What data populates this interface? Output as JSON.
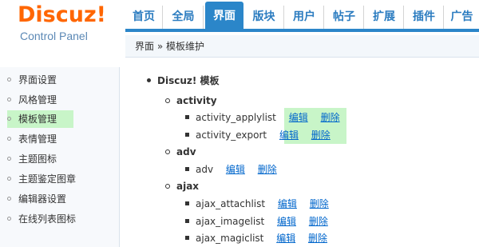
{
  "logo": {
    "title": "Discuz!",
    "subtitle": "Control Panel"
  },
  "nav": {
    "tabs": [
      {
        "label": "首页"
      },
      {
        "label": "全局"
      },
      {
        "label": "界面",
        "active": true
      },
      {
        "label": "版块"
      },
      {
        "label": "用户"
      },
      {
        "label": "帖子"
      },
      {
        "label": "扩展"
      },
      {
        "label": "插件"
      },
      {
        "label": "广告"
      }
    ]
  },
  "breadcrumb": {
    "text": "界面 » 模板维护"
  },
  "sidebar": {
    "items": [
      {
        "label": "界面设置"
      },
      {
        "label": "风格管理"
      },
      {
        "label": "模板管理",
        "active": true
      },
      {
        "label": "表情管理"
      },
      {
        "label": "主题图标"
      },
      {
        "label": "主题鉴定图章"
      },
      {
        "label": "编辑器设置"
      },
      {
        "label": "在线列表图标"
      }
    ]
  },
  "tree": {
    "root": "Discuz! 模板",
    "edit_label": "编辑",
    "delete_label": "删除",
    "groups": [
      {
        "name": "activity",
        "files": [
          "activity_applylist",
          "activity_export"
        ]
      },
      {
        "name": "adv",
        "files": [
          "adv"
        ]
      },
      {
        "name": "ajax",
        "files": [
          "ajax_attachlist",
          "ajax_imagelist",
          "ajax_magiclist"
        ]
      }
    ]
  }
}
